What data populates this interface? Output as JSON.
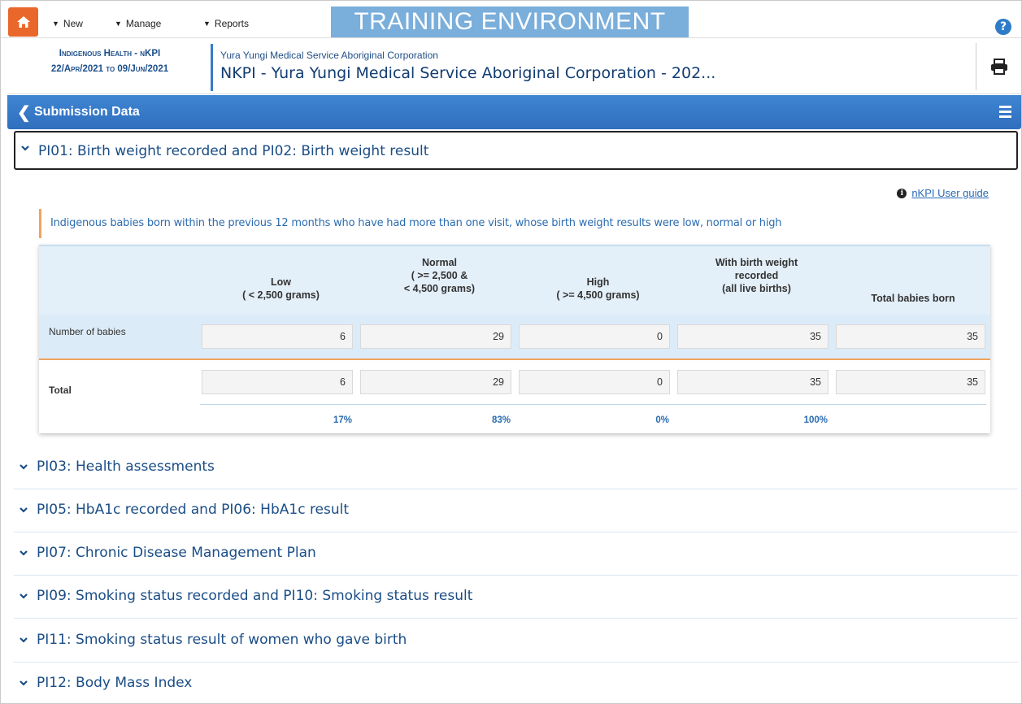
{
  "nav": {
    "menus": [
      "New",
      "Manage",
      "Reports"
    ],
    "training_banner": "TRAINING ENVIRONMENT",
    "help_icon": "question-circle-icon",
    "home_icon": "home-icon"
  },
  "header": {
    "form_type": "Indigenous Health - nKPI",
    "date_range": "22/Apr/2021 to 09/Jun/2021",
    "organisation": "Yura Yungi Medical Service Aboriginal Corporation",
    "title": "NKPI - Yura Yungi Medical Service Aboriginal Corporation - 202...",
    "print_icon": "printer-icon"
  },
  "subbar": {
    "title": "Submission Data"
  },
  "section_open": {
    "title": "PI01: Birth weight recorded and PI02: Birth weight result",
    "guide_link": "nKPI User guide",
    "description": "Indigenous babies born within the previous 12 months who have had more than one visit, whose birth weight results were low, normal or high",
    "columns": [
      [
        "Low",
        "( < 2,500 grams)"
      ],
      [
        "Normal",
        "( >= 2,500 &",
        "< 4,500 grams)"
      ],
      [
        "High",
        "( >= 4,500 grams)"
      ],
      [
        "With birth weight",
        "recorded",
        "(all live births)"
      ],
      [
        "Total babies born"
      ]
    ],
    "row_label": "Number of babies",
    "row_values": [
      "6",
      "29",
      "0",
      "35",
      "35"
    ],
    "total_label": "Total",
    "total_values": [
      "6",
      "29",
      "0",
      "35",
      "35"
    ],
    "percentages": [
      "17%",
      "83%",
      "0%",
      "100%"
    ]
  },
  "sections_collapsed": [
    "PI03: Health assessments",
    "PI05: HbA1c recorded and PI06: HbA1c result",
    "PI07: Chronic Disease Management Plan",
    "PI09: Smoking status recorded and PI10: Smoking status result",
    "PI11: Smoking status result of women who gave birth",
    "PI12: Body Mass Index"
  ],
  "colors": {
    "accent": "#2f6fbe",
    "home": "#e9672a",
    "highlight": "#f0a35e"
  }
}
